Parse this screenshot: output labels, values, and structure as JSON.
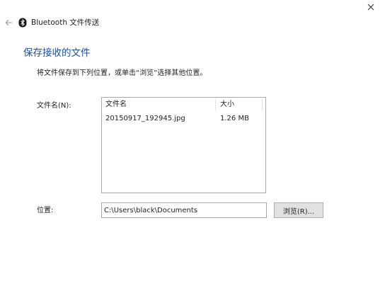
{
  "window": {
    "title": "Bluetooth 文件传送",
    "close_icon": "close-icon",
    "back_icon": "back-arrow-icon",
    "app_icon": "bluetooth-icon"
  },
  "page": {
    "heading": "保存接收的文件",
    "instruction": "将文件保存到下列位置，或单击“浏览”选择其他位置。",
    "files_label": "文件名(N):",
    "location_label": "位置:"
  },
  "file_list": {
    "columns": [
      "文件名",
      "大小"
    ],
    "rows": [
      {
        "name": "20150917_192945.jpg",
        "size": "1.26 MB"
      }
    ]
  },
  "location": {
    "value": "C:\\Users\\black\\Documents"
  },
  "buttons": {
    "browse_label": "浏览(R)..."
  },
  "colors": {
    "heading": "#1f4e9c",
    "border": "#a9a9a9",
    "button_bg": "#e1e1e1"
  }
}
